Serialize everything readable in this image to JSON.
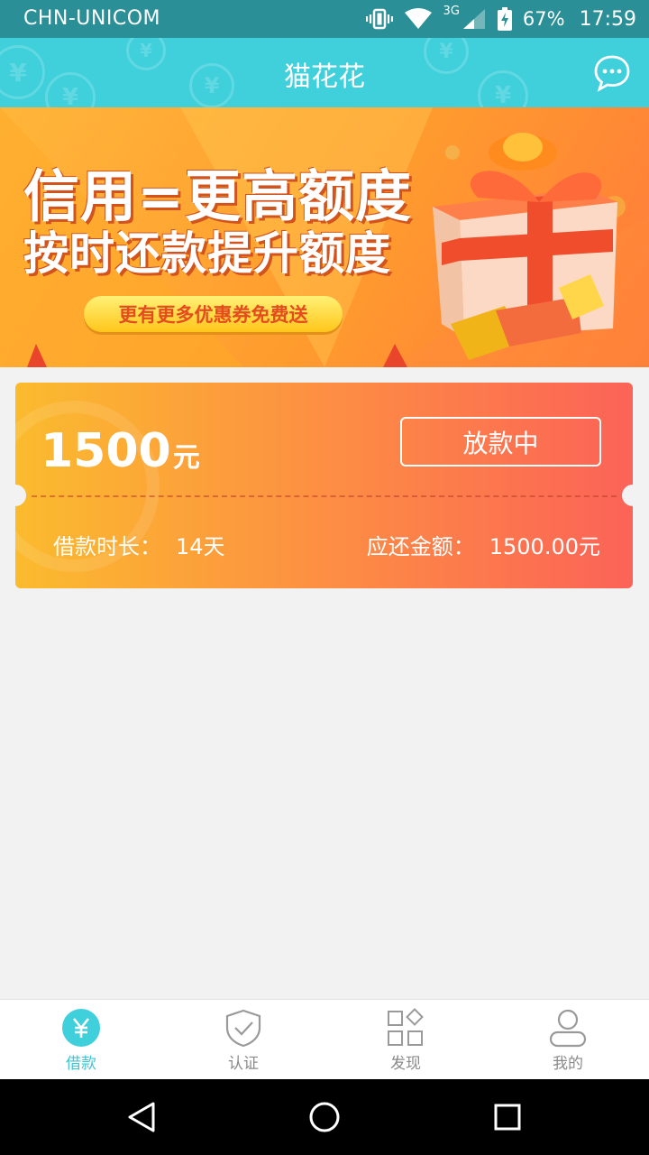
{
  "status_bar": {
    "carrier": "CHN-UNICOM",
    "network": "3G",
    "battery": "67%",
    "time": "17:59"
  },
  "app_bar": {
    "title": "猫花花",
    "chat_icon": "chat-bubble-icon"
  },
  "banner": {
    "line1": "信用=更高额度",
    "line2": "按时还款提升额度",
    "pill": "更有更多优惠券免费送"
  },
  "loan_card": {
    "amount": "1500",
    "amount_unit": "元",
    "status_button": "放款中",
    "term_label": "借款时长：",
    "term_value": "14天",
    "due_label": "应还金额：",
    "due_value": "1500.00元"
  },
  "bottom_nav": {
    "items": [
      {
        "label": "借款",
        "icon": "yen-circle-icon",
        "active": true
      },
      {
        "label": "认证",
        "icon": "shield-check-icon",
        "active": false
      },
      {
        "label": "发现",
        "icon": "grid-discover-icon",
        "active": false
      },
      {
        "label": "我的",
        "icon": "user-icon",
        "active": false
      }
    ]
  },
  "colors": {
    "status_bar": "#2b8f97",
    "app_bar": "#3fd0dc",
    "accent": "#3fc6d2",
    "card_start": "#fbbb2e",
    "card_end": "#fb6357"
  }
}
